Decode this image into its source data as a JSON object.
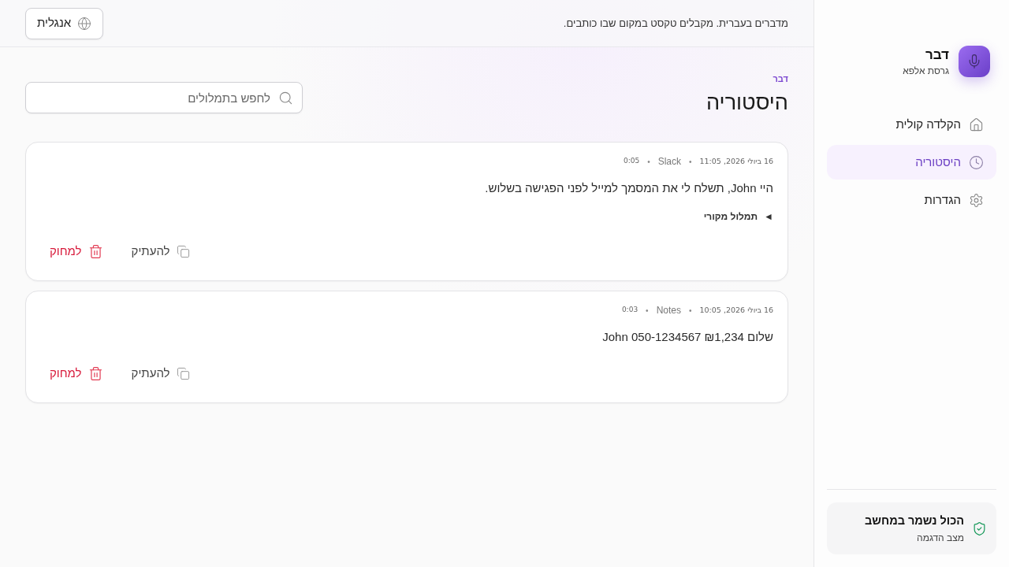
{
  "sidebar": {
    "app_name": "דבר",
    "version": "גרסת אלפא",
    "nav": [
      {
        "label": "הקלדה קולית",
        "selected": false
      },
      {
        "label": "היסטוריה",
        "selected": true
      },
      {
        "label": "הגדרות",
        "selected": false
      }
    ],
    "privacy": {
      "title": "הכול נשמר במחשב",
      "subtitle": "מצב הדגמה"
    }
  },
  "topbar": {
    "tagline": "מדברים בעברית. מקבלים טקסט במקום שבו כותבים.",
    "language_button": "אנגלית"
  },
  "page": {
    "eyebrow": "דבר",
    "title": "היסטוריה",
    "search": {
      "placeholder": "לחפש בתמלולים"
    }
  },
  "transcripts": [
    {
      "meta": [
        {
          "kind": "date",
          "text": "16 ביולי 2026, 11:05"
        },
        {
          "kind": "dot",
          "text": "•"
        },
        {
          "kind": "app",
          "text": "Slack"
        },
        {
          "kind": "dot",
          "text": "•"
        },
        {
          "kind": "duration",
          "text": "0:05"
        }
      ],
      "text": "היי John, תשלח לי את המסמך למייל לפני הפגישה בשלוש.",
      "original": {
        "marker": "◄",
        "label": "תמלול מקורי"
      },
      "actions": [
        {
          "kind": "copy",
          "label": "להעתיק"
        },
        {
          "kind": "delete",
          "label": "למחוק"
        }
      ]
    },
    {
      "meta": [
        {
          "kind": "date",
          "text": "16 ביולי 2026, 10:05"
        },
        {
          "kind": "dot",
          "text": "•"
        },
        {
          "kind": "app",
          "text": "Notes"
        },
        {
          "kind": "dot",
          "text": "•"
        },
        {
          "kind": "duration",
          "text": "0:03"
        }
      ],
      "text": "שלום ₪1,234 050-1234567 John",
      "actions": [
        {
          "kind": "copy",
          "label": "להעתיק"
        },
        {
          "kind": "delete",
          "label": "למחוק"
        }
      ]
    }
  ]
}
